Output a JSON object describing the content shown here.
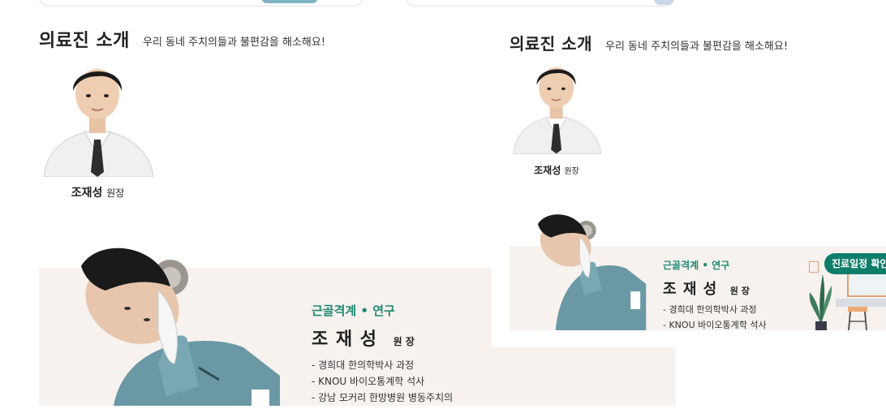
{
  "left": {
    "heading": "의료진 소개",
    "subheading": "우리 동네 주치의들과 불편감을 해소해요!",
    "doctor": {
      "name": "조재성",
      "role": "원장"
    },
    "banner": {
      "specialty": "근골격계 • 연구",
      "name": "조 재 성",
      "role": "원 장",
      "credentials": [
        "- 경희대 한의학박사 과정",
        "- KNOU 바이오통계학 석사",
        "- 강남 모커리 한방병원 병동주치의"
      ]
    }
  },
  "right": {
    "heading": "의료진 소개",
    "subheading": "우리 동네 주치의들과 불편감을 해소해요!",
    "doctor": {
      "name": "조재성",
      "role": "원장"
    },
    "banner": {
      "specialty": "근골격계 • 연구",
      "name": "조 재 성",
      "role": "원 장",
      "credentials": [
        "- 경희대 한의학박사 과정",
        "- KNOU 바이오통계학 석사"
      ]
    },
    "schedule_button": "진료일정 확인"
  },
  "colors": {
    "accent": "#1e8a72",
    "banner_bg": "#f7f2ee",
    "button": "#0e7e6a",
    "scrubs": "#6a98a4"
  },
  "icons": [
    "doctor-portrait",
    "doctor-stretching-photo",
    "plant-icon",
    "frame-icon",
    "stool-icon"
  ]
}
